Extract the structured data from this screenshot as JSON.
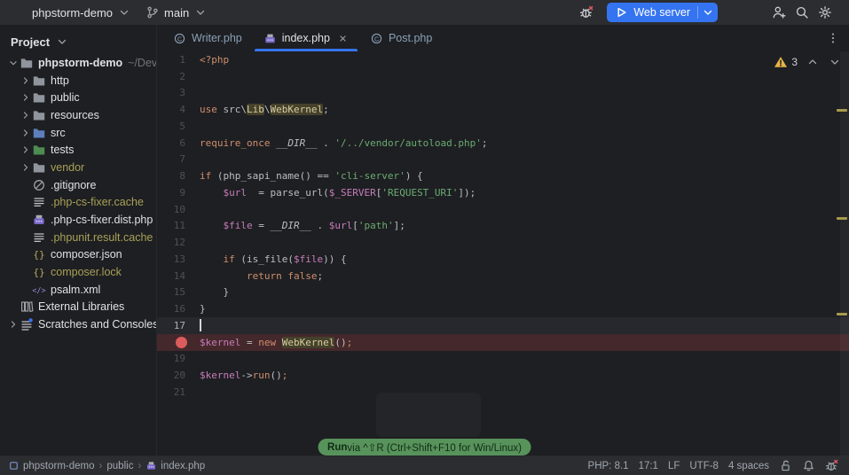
{
  "colors": {
    "accent_blue": "#3574F0",
    "run_hint_green": "#57935B",
    "warning_yellow": "#E8B349",
    "breakpoint_red": "#DB5C5C",
    "keyword_orange": "#CF8E6D",
    "string_green": "#6AAB73",
    "variable_purple": "#C77DBB",
    "ignored_olive": "#A8A157"
  },
  "titlebar": {
    "project_selector": "phpstorm-demo",
    "branch": "main",
    "run_widget": "Web server",
    "icons": [
      "bug-x",
      "play",
      "chevron-down",
      "person-add",
      "search",
      "gear"
    ]
  },
  "tabs": [
    {
      "label": "Writer.php",
      "icon": "php-class",
      "active": false,
      "closable": false
    },
    {
      "label": "index.php",
      "icon": "php-file",
      "active": true,
      "closable": true
    },
    {
      "label": "Post.php",
      "icon": "php-class",
      "active": false,
      "closable": false
    }
  ],
  "project_panel": {
    "header": "Project",
    "tree": [
      {
        "label": "phpstorm-demo",
        "suffix": "~/Dev/p",
        "depth": 0,
        "chevron": "down",
        "icon": "folder",
        "bold": true
      },
      {
        "label": "http",
        "depth": 1,
        "chevron": "right",
        "icon": "folder"
      },
      {
        "label": "public",
        "depth": 1,
        "chevron": "right",
        "icon": "folder"
      },
      {
        "label": "resources",
        "depth": 1,
        "chevron": "right",
        "icon": "folder"
      },
      {
        "label": "src",
        "depth": 1,
        "chevron": "right",
        "icon": "folder-blue"
      },
      {
        "label": "tests",
        "depth": 1,
        "chevron": "right",
        "icon": "folder-green"
      },
      {
        "label": "vendor",
        "depth": 1,
        "chevron": "right",
        "icon": "folder",
        "color": "olive"
      },
      {
        "label": ".gitignore",
        "depth": 1,
        "chevron": "none",
        "icon": "ignored"
      },
      {
        "label": ".php-cs-fixer.cache",
        "depth": 1,
        "chevron": "none",
        "icon": "text-file",
        "color": "olive"
      },
      {
        "label": ".php-cs-fixer.dist.php",
        "depth": 1,
        "chevron": "none",
        "icon": "php-file"
      },
      {
        "label": ".phpunit.result.cache",
        "depth": 1,
        "chevron": "none",
        "icon": "text-file",
        "color": "olive"
      },
      {
        "label": "composer.json",
        "depth": 1,
        "chevron": "none",
        "icon": "braces"
      },
      {
        "label": "composer.lock",
        "depth": 1,
        "chevron": "none",
        "icon": "braces",
        "color": "olive"
      },
      {
        "label": "psalm.xml",
        "depth": 1,
        "chevron": "none",
        "icon": "xml"
      },
      {
        "label": "External Libraries",
        "depth": 0,
        "chevron": "none",
        "icon": "library"
      },
      {
        "label": "Scratches and Consoles",
        "depth": 0,
        "chevron": "right",
        "icon": "scratch"
      }
    ]
  },
  "editor": {
    "warning_count": "3",
    "current_line": 17,
    "breakpoint_line": 18,
    "stripe_marks_y": [
      65,
      187,
      295
    ],
    "lines": [
      {
        "n": 1,
        "seg": [
          [
            "<?php",
            "kw"
          ]
        ]
      },
      {
        "n": 2,
        "seg": []
      },
      {
        "n": 3,
        "seg": []
      },
      {
        "n": 4,
        "seg": [
          [
            "use",
            "kw"
          ],
          [
            " src\\",
            "fg"
          ],
          [
            "Lib",
            "hl"
          ],
          [
            "\\",
            "fg"
          ],
          [
            "WebKernel",
            "hl"
          ],
          [
            ";",
            "fg"
          ]
        ]
      },
      {
        "n": 5,
        "seg": []
      },
      {
        "n": 6,
        "seg": [
          [
            "require_once",
            "kw"
          ],
          [
            " ",
            "fg"
          ],
          [
            "__DIR__",
            "cn"
          ],
          [
            " . ",
            "fg"
          ],
          [
            "'/../vendor/autoload.php'",
            "str"
          ],
          [
            ";",
            "fg"
          ]
        ]
      },
      {
        "n": 7,
        "seg": []
      },
      {
        "n": 8,
        "seg": [
          [
            "if",
            "kw"
          ],
          [
            " (php_sapi_name() == ",
            "fg"
          ],
          [
            "'cli-server'",
            "str"
          ],
          [
            ") {",
            "fg"
          ]
        ]
      },
      {
        "n": 9,
        "seg": [
          [
            "    ",
            "fg"
          ],
          [
            "$url",
            "var"
          ],
          [
            "  = parse_url(",
            "fg"
          ],
          [
            "$_SERVER",
            "var"
          ],
          [
            "[",
            "fg"
          ],
          [
            "'REQUEST_URI'",
            "str"
          ],
          [
            "]);",
            "fg"
          ]
        ]
      },
      {
        "n": 10,
        "seg": []
      },
      {
        "n": 11,
        "seg": [
          [
            "    ",
            "fg"
          ],
          [
            "$file",
            "var"
          ],
          [
            " = ",
            "fg"
          ],
          [
            "__DIR__",
            "cn"
          ],
          [
            " . ",
            "fg"
          ],
          [
            "$url",
            "var"
          ],
          [
            "[",
            "fg"
          ],
          [
            "'path'",
            "str"
          ],
          [
            "];",
            "fg"
          ]
        ]
      },
      {
        "n": 12,
        "seg": []
      },
      {
        "n": 13,
        "seg": [
          [
            "    ",
            "fg"
          ],
          [
            "if",
            "kw"
          ],
          [
            " (is_file(",
            "fg"
          ],
          [
            "$file",
            "var"
          ],
          [
            ")) {",
            "fg"
          ]
        ]
      },
      {
        "n": 14,
        "seg": [
          [
            "        ",
            "fg"
          ],
          [
            "return",
            "kw"
          ],
          [
            " ",
            "fg"
          ],
          [
            "false",
            "kw"
          ],
          [
            ";",
            "fg"
          ]
        ]
      },
      {
        "n": 15,
        "seg": [
          [
            "    }",
            "fg"
          ]
        ]
      },
      {
        "n": 16,
        "seg": [
          [
            "}",
            "fg"
          ]
        ]
      },
      {
        "n": 17,
        "seg": []
      },
      {
        "n": 18,
        "seg": [
          [
            "$kernel",
            "var"
          ],
          [
            " = ",
            "fg"
          ],
          [
            "new",
            "kw"
          ],
          [
            " ",
            "fg"
          ],
          [
            "WebKernel",
            "hl"
          ],
          [
            "()",
            "fg"
          ],
          [
            ";",
            "kw"
          ]
        ]
      },
      {
        "n": 19,
        "seg": []
      },
      {
        "n": 20,
        "seg": [
          [
            "$kernel",
            "var"
          ],
          [
            "->",
            "fg"
          ],
          [
            "run",
            "kw"
          ],
          [
            "()",
            "fg"
          ],
          [
            ";",
            "kw"
          ]
        ]
      },
      {
        "n": 21,
        "seg": []
      }
    ]
  },
  "hint": {
    "action": "Run",
    "rest": " via ^⇧R (Ctrl+Shift+F10 for Win/Linux)"
  },
  "statusbar": {
    "breadcrumbs": [
      {
        "label": "phpstorm-demo",
        "icon": "project-square"
      },
      {
        "label": "public",
        "icon": ""
      },
      {
        "label": "index.php",
        "icon": "php-file"
      }
    ],
    "widgets": [
      {
        "label": "PHP: 8.1",
        "name": "php-version"
      },
      {
        "label": "17:1",
        "name": "caret-position"
      },
      {
        "label": "LF",
        "name": "line-ending"
      },
      {
        "label": "UTF-8",
        "name": "encoding"
      },
      {
        "label": "4 spaces",
        "name": "indent-style"
      }
    ],
    "icons": [
      {
        "icon": "lock-open",
        "name": "readonly-toggle"
      },
      {
        "icon": "bell",
        "name": "notifications-button"
      },
      {
        "icon": "bug-x",
        "name": "debug-listener-toggle"
      }
    ]
  }
}
